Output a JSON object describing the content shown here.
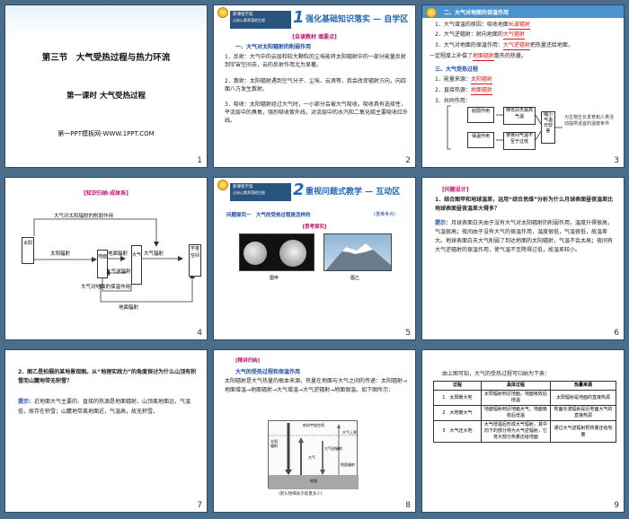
{
  "slides": [
    {
      "number": "1",
      "title": "第三节　大气受热过程与热力环流",
      "subtitle": "第一课时 大气受热过程",
      "footer": "第一PPT模板网-WWW.1PPT.COM"
    },
    {
      "number": "2",
      "badge_line1": "新课程学案",
      "badge_line2": "让核心素养落地生根",
      "section_num": "1",
      "section_title": "强化基础知识落实 — 自学区",
      "tag": "[自读教材 填要点]",
      "heading": "一、大气对太阳辐射的削弱作用",
      "p1": "1．反射：大气中的云层和较大颗粒的尘埃能将太阳辐射中的一部分能量反射到宇宙空间去，云的反射作用尤为显著。",
      "p2": "2．散射：太阳辐射遇到空气分子、尘埃、云滴等，我会改变辐射方向，向四面八方发生散射。",
      "p3": "3．吸收：太阳辐射经过大气时，一小部分会被大气吸收。吸收具有选择性，平流层中的臭氧，强烈吸收紫外线，对流层中的水汽和二氧化碳主要吸收红外线。",
      "blanks": [
        "云层",
        "反射",
        "云",
        "空气分子",
        "吸收",
        "选择性",
        "紫外线",
        "红外线"
      ]
    },
    {
      "number": "3",
      "heading1": "二、大气对地面的保温作用",
      "l1": "1．大气增温的原因：吸收地面",
      "l1_blank": "长波辐射",
      "l2": "2．大气逆辐射：射向地面的",
      "l2_blank": "大气辐射",
      "l3a": "3．大气对地面的保温作用：",
      "l3_blank": "大气逆辐射",
      "l3b": "把热量还给地面，",
      "l3c": "一定程度上补偿了",
      "l3_blank2": "地面辐射",
      "l3d": "散失的热量。",
      "heading2": "三、大气受热过程",
      "m1": "1．能量来源：",
      "m1_blank": "太阳辐射",
      "m2": "2．直接热源：",
      "m2_blank": "地面辐射",
      "m3": "3．共同作用：",
      "boxes": [
        "削弱作用",
        "降低白天最高气温",
        "缩小气温日较差",
        "保温作用",
        "使夜间气温不至于过低",
        "为生物生长发育和人类活动提供适宜的温度条件"
      ]
    },
    {
      "number": "4",
      "tag": "[知识归纳·成体系]",
      "top_label": "大气对太阳辐射的削弱作用",
      "sun": "太阳",
      "solar": "太阳辐射",
      "ground_rad": "地面辐射",
      "atm": "大气",
      "atm_rad": "大气辐射",
      "space": "宇宙空间",
      "ground": "地面",
      "back_rad": "大气逆辐射",
      "warm_label": "大气对地面的保温作用",
      "bottom_rad": "地面辐射"
    },
    {
      "number": "5",
      "badge_line1": "新课程学案",
      "badge_line2": "让核心素养落地生根",
      "section_num": "2",
      "section_title": "重视问题式教学 — 互动区",
      "q_title": "问题探究一　大气的受热过程是怎样的",
      "q_tag": "(重难考点)",
      "sub_tag": "[思考探究]",
      "cap1": "图甲",
      "cap2": "图乙"
    },
    {
      "number": "6",
      "tag": "[问题设计]",
      "q": "1．结合图甲和地球温差，运用“综合思维”分析为什么月球表面昼夜温差比地球表面昼夜温差大得多？",
      "a_label": "提示：",
      "a": "月球表面白天由于没有大气对太阳辐射的削弱作用，温度升得很高，气温很高；夜间由于没有大气的保温作用，温度很低，气温很低，故温差大。地球表面白天大气削弱了到达地面的太阳辐射，气温不会太高；夜间有大气逆辐射的保温作用，使气温不至降得过低，故温差较小。"
    },
    {
      "number": "7",
      "q": "2．图乙是拍摄的某地景观图。从“地理实践力”的角度探讨为什么山顶有积雪而山麓地带无积雪？",
      "a_label": "提示：",
      "a": "近地面大气主要的、直接的热源是地面辐射。山顶离地面远，气温低，故存在积雪；山麓地带离地面近，气温高，故无积雪。"
    },
    {
      "number": "8",
      "tag": "[精讲归纳]",
      "heading": "大气的受热过程和保温作用",
      "p1": "太阳辐射是大气热量的根本来源，热量在地面与大气之间的传递：太阳辐射→地面增温→地面辐射→大气增温→大气逆辐射→地面保温。如下图所示：",
      "fig_labels": [
        "太阳辐射",
        "射向宇宙空间",
        "大气上界",
        "大气",
        "地面",
        "大气逆辐射",
        "地面辐射"
      ],
      "legend": "(箭头粗细表示能量多少)"
    },
    {
      "number": "9",
      "intro": "由上图可知，大气的受热过程可归纳为下表：",
      "headers": [
        "过程",
        "具体过程",
        "热量来源"
      ],
      "rows": [
        [
          "1　太阳暖大地",
          "太阳辐射到达地面，地面吸收后增温",
          "太阳辐射是地面的直接热源"
        ],
        [
          "2　大地暖大气",
          "地面辐射到近地面大气，地面吸收后增温",
          "地面长波辐射是近地面大气的直接热源"
        ],
        [
          "3　大气还大地",
          "大气增温后形成大气辐射，其中向下的部分称为大气逆辐射，它将大部分热量还给地面",
          "通过大气逆辐射把热量还给地面"
        ]
      ]
    }
  ]
}
